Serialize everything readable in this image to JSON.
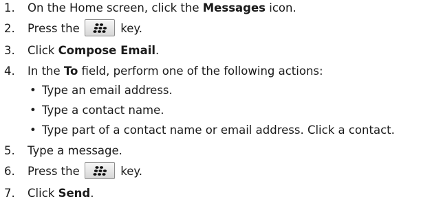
{
  "steps": [
    {
      "num": "1.",
      "before": "On the Home screen, click the ",
      "bold": "Messages",
      "after": " icon."
    },
    {
      "num": "2.",
      "before": "Press the ",
      "key_icon": "blackberry-menu-key-icon",
      "after": " key."
    },
    {
      "num": "3.",
      "before": "Click ",
      "bold": "Compose Email",
      "after": "."
    },
    {
      "num": "4.",
      "before": "In the ",
      "bold": "To",
      "after": " field, perform one of the following actions:",
      "subitems": [
        "Type an email address.",
        "Type a contact name.",
        "Type part of a contact name or email address. Click a contact."
      ]
    },
    {
      "num": "5.",
      "before": "Type a message."
    },
    {
      "num": "6.",
      "before": "Press the ",
      "key_icon": "blackberry-menu-key-icon",
      "after": " key."
    },
    {
      "num": "7.",
      "before": "Click ",
      "bold": "Send",
      "after": "."
    }
  ],
  "bullet": "•",
  "colors": {
    "text": "#1a1a1a",
    "key_border": "#8c8c8c"
  }
}
